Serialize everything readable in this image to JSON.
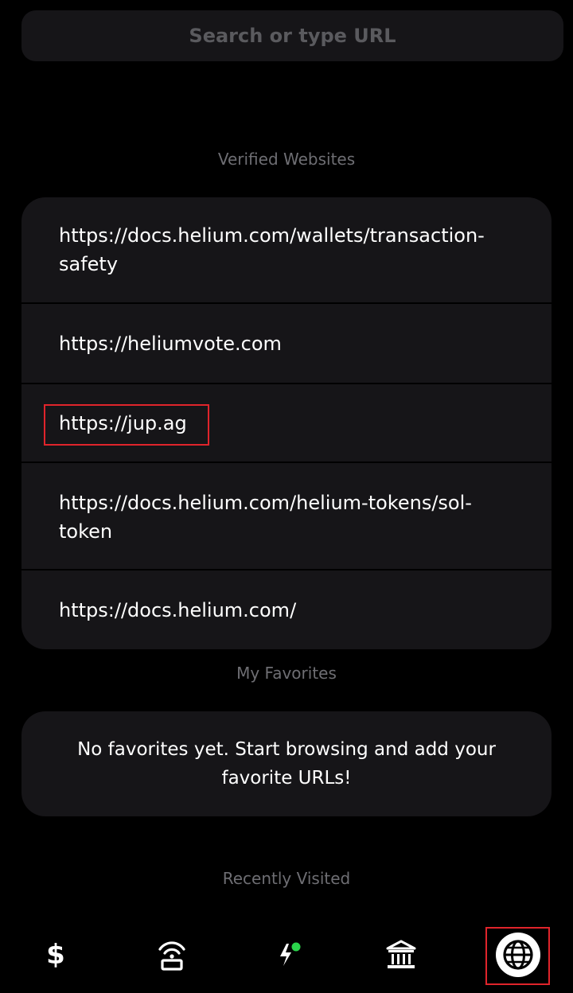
{
  "search": {
    "placeholder": "Search or type URL"
  },
  "verified": {
    "title": "Verified Websites",
    "items": [
      {
        "line1": "https://docs.helium.com/wallets/transaction-",
        "line2": "safety"
      },
      {
        "line1": "https://heliumvote.com",
        "line2": ""
      },
      {
        "line1": "https://jup.ag",
        "line2": ""
      },
      {
        "line1": "https://docs.helium.com/helium-tokens/sol-",
        "line2": "token"
      },
      {
        "line1": "https://docs.helium.com/",
        "line2": ""
      }
    ]
  },
  "favorites": {
    "title": "My Favorites",
    "empty_message": "No favorites yet. Start browsing and add your favorite URLs!"
  },
  "recent": {
    "title": "Recently Visited"
  },
  "tabs": {
    "wallet_glyph": "$",
    "items": [
      {
        "name": "wallet",
        "icon": "dollar-icon"
      },
      {
        "name": "hotspots",
        "icon": "hotspot-icon"
      },
      {
        "name": "activity",
        "icon": "lightning-icon",
        "badge_color": "#2ad44b"
      },
      {
        "name": "governance",
        "icon": "bank-icon"
      },
      {
        "name": "browser",
        "icon": "globe-icon",
        "active": true
      }
    ]
  },
  "colors": {
    "highlight": "#e0242b",
    "card": "#161518",
    "badge": "#2ad44b"
  }
}
